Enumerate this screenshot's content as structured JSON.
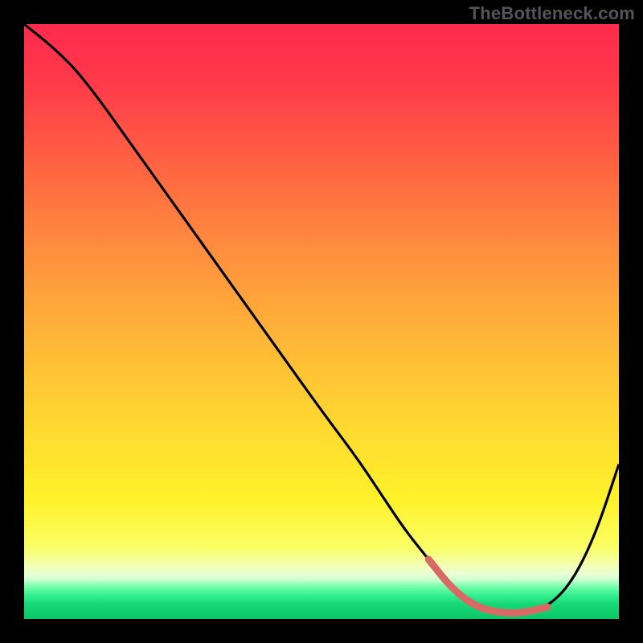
{
  "watermark": "TheBottleneck.com",
  "colors": {
    "background": "#000000",
    "watermark_text": "#555559",
    "curve_main": "#000000",
    "curve_highlight": "#d86a66",
    "gradient_top": "#ff2a4d",
    "gradient_bottom": "#0cc668"
  },
  "chart_data": {
    "type": "line",
    "title": "",
    "xlabel": "",
    "ylabel": "",
    "xlim": [
      0,
      100
    ],
    "ylim": [
      0,
      100
    ],
    "grid": false,
    "legend": null,
    "series": [
      {
        "name": "bottleneck-curve",
        "x": [
          0,
          5,
          10,
          20,
          30,
          40,
          50,
          56,
          60,
          64,
          68,
          72,
          76,
          80,
          84,
          88,
          92,
          96,
          100
        ],
        "y": [
          100,
          96,
          91,
          77,
          63,
          49,
          35,
          27,
          21,
          15,
          10,
          5,
          2,
          1,
          1,
          2,
          6,
          14,
          26
        ]
      }
    ],
    "highlight": {
      "name": "sweet-spot",
      "x": [
        68,
        72,
        76,
        80,
        84,
        88
      ],
      "y": [
        10,
        5,
        2,
        1,
        1,
        2
      ]
    }
  }
}
